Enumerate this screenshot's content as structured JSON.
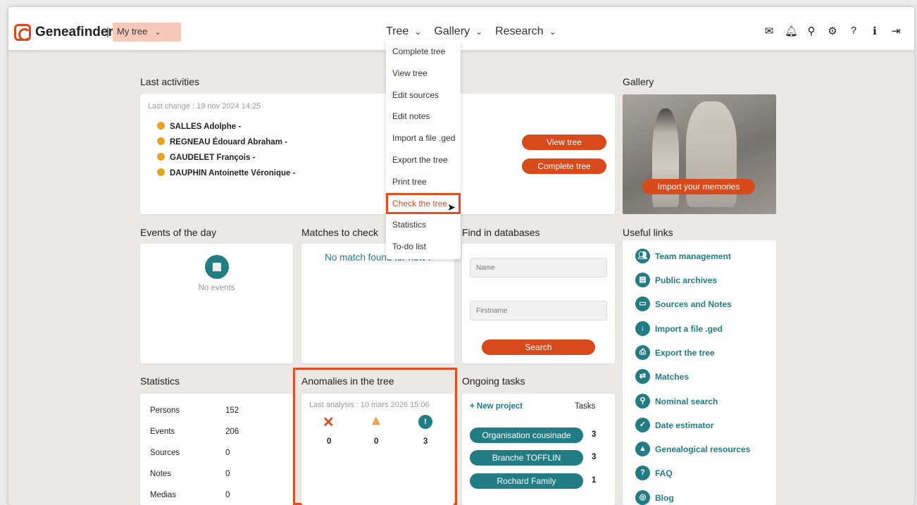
{
  "brand": {
    "name": "Geneafinder",
    "separator": "|"
  },
  "tree_selector": {
    "value": "My tree"
  },
  "nav": {
    "items": [
      {
        "label": "Tree"
      },
      {
        "label": "Gallery"
      },
      {
        "label": "Research"
      }
    ]
  },
  "tools": {
    "icons": [
      "mail-icon",
      "bell-icon",
      "search-icon",
      "gear-icon",
      "help-icon",
      "info-icon",
      "logout-icon"
    ]
  },
  "tree_menu": {
    "items": [
      "Complete tree",
      "View tree",
      "Edit sources",
      "Edit notes",
      "Import a file .ged",
      "Export the tree",
      "Print tree",
      "Check the tree",
      "Statistics",
      "To-do list"
    ],
    "active_index": 7
  },
  "last_activities": {
    "title": "Last activities",
    "last_change": "Last change : 19 nov 2024 14:25",
    "people": [
      "SALLES Adolphe -",
      "REGNEAU Édouard Abraham -",
      "GAUDELET François -",
      "DAUPHIN Antoinette Véronique -"
    ],
    "view_tree_label": "View tree",
    "complete_tree_label": "Complete tree"
  },
  "gallery": {
    "title": "Gallery",
    "import_label": "Import your memories"
  },
  "events": {
    "title": "Events of the day",
    "empty": "No events"
  },
  "matches": {
    "title": "Matches to check",
    "empty": "No match found for now !"
  },
  "find": {
    "title": "Find in databases",
    "name_placeholder": "Name",
    "firstname_placeholder": "Firstname",
    "search_label": "Search"
  },
  "useful_links": {
    "title": "Useful links",
    "items": [
      "Team management",
      "Public archives",
      "Sources and Notes",
      "Import a file .ged",
      "Export the tree",
      "Matches",
      "Nominal search",
      "Date estimator",
      "Genealogical resources",
      "FAQ",
      "Blog"
    ]
  },
  "statistics": {
    "title": "Statistics",
    "rows": [
      {
        "label": "Persons",
        "value": "152"
      },
      {
        "label": "Events",
        "value": "206"
      },
      {
        "label": "Sources",
        "value": "0"
      },
      {
        "label": "Notes",
        "value": "0"
      },
      {
        "label": "Medias",
        "value": "0"
      }
    ]
  },
  "anomalies": {
    "title": "Anomalies in the tree",
    "last_analysis": "Last analysis : 10 mars 2026 15:06",
    "errors": "0",
    "warnings": "0",
    "infos": "3"
  },
  "tasks": {
    "title": "Ongoing tasks",
    "new_project": "+ New project",
    "tasks_header": "Tasks",
    "projects": [
      {
        "name": "Organisation cousinade",
        "count": "3"
      },
      {
        "name": "Branche TOFFLIN",
        "count": "3"
      },
      {
        "name": "Rochard Family",
        "count": "1"
      }
    ]
  },
  "colors": {
    "accent": "#d84a1b",
    "teal": "#217c83",
    "dot": "#e8a21b"
  }
}
